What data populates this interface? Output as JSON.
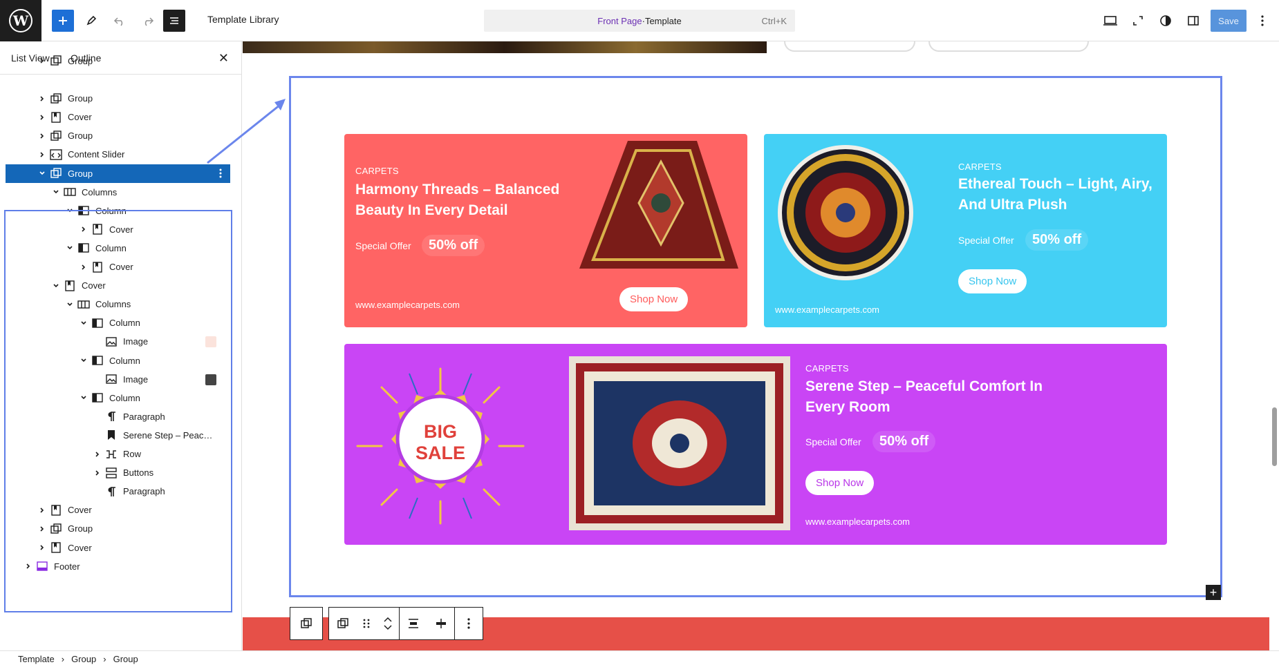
{
  "topbar": {
    "title": "Template Library",
    "command": {
      "front": "Front Page",
      "sep": " · ",
      "tpl": "Template",
      "shortcut": "Ctrl+K"
    },
    "save_label": "Save"
  },
  "sidebar": {
    "tabs": [
      "List View",
      "Outline"
    ],
    "close": "✕",
    "items": [
      {
        "label": "Group",
        "icon": "group-icon",
        "chev": "right"
      },
      {
        "label": "Group",
        "icon": "group-icon",
        "chev": "right"
      },
      {
        "label": "Cover",
        "icon": "cover-icon",
        "chev": "right"
      },
      {
        "label": "Group",
        "icon": "group-icon",
        "chev": "right"
      },
      {
        "label": "Content Slider",
        "icon": "code-icon",
        "chev": "right"
      },
      {
        "label": "Group",
        "icon": "group-icon",
        "chev": "down",
        "selected": true
      },
      {
        "label": "Columns",
        "icon": "columns-icon",
        "chev": "down"
      },
      {
        "label": "Column",
        "icon": "column-icon",
        "chev": "down"
      },
      {
        "label": "Cover",
        "icon": "cover-icon",
        "chev": "right"
      },
      {
        "label": "Column",
        "icon": "column-icon",
        "chev": "down"
      },
      {
        "label": "Cover",
        "icon": "cover-icon",
        "chev": "right"
      },
      {
        "label": "Cover",
        "icon": "cover-icon",
        "chev": "down"
      },
      {
        "label": "Columns",
        "icon": "columns-icon",
        "chev": "down"
      },
      {
        "label": "Column",
        "icon": "column-icon",
        "chev": "down"
      },
      {
        "label": "Image",
        "icon": "image-icon",
        "chev": ""
      },
      {
        "label": "Column",
        "icon": "column-icon",
        "chev": "down"
      },
      {
        "label": "Image",
        "icon": "image-icon",
        "chev": ""
      },
      {
        "label": "Column",
        "icon": "column-icon",
        "chev": "down"
      },
      {
        "label": "Paragraph",
        "icon": "paragraph-icon",
        "chev": ""
      },
      {
        "label": "Serene Step – Peac…",
        "icon": "heading-icon",
        "chev": ""
      },
      {
        "label": "Row",
        "icon": "row-icon",
        "chev": "right"
      },
      {
        "label": "Buttons",
        "icon": "buttons-icon",
        "chev": "right"
      },
      {
        "label": "Paragraph",
        "icon": "paragraph-icon",
        "chev": ""
      },
      {
        "label": "Cover",
        "icon": "cover-icon",
        "chev": "right"
      },
      {
        "label": "Group",
        "icon": "group-icon",
        "chev": "right"
      },
      {
        "label": "Cover",
        "icon": "cover-icon",
        "chev": "right"
      },
      {
        "label": "Footer",
        "icon": "footer-icon",
        "chev": "right"
      }
    ]
  },
  "cards": {
    "red": {
      "tag": "CARPETS",
      "title1": "Harmony Threads – Balanced",
      "title2": "Beauty In Every Detail",
      "special": "Special Offer",
      "off": "50% off",
      "shop": "Shop Now",
      "url": "www.examplecarpets.com"
    },
    "blue": {
      "tag": "CARPETS",
      "title1": "Ethereal Touch – Light, Airy,",
      "title2": "And Ultra Plush",
      "special": "Special Offer",
      "off": "50% off",
      "shop": "Shop Now",
      "url": "www.examplecarpets.com"
    },
    "purple": {
      "tag": "CARPETS",
      "title1": "Serene Step – Peaceful Comfort In",
      "title2": "Every Room",
      "special": "Special Offer",
      "off": "50% off",
      "shop": "Shop Now",
      "url": "www.examplecarpets.com",
      "sale1": "BIG",
      "sale2": "SALE"
    }
  },
  "breadcrumb": [
    "Template",
    "Group",
    "Group"
  ],
  "colors": {
    "accent": "#1467b8",
    "red_card": "#ff6464",
    "blue_card": "#44d0f5",
    "purple_card": "#c945f5"
  }
}
